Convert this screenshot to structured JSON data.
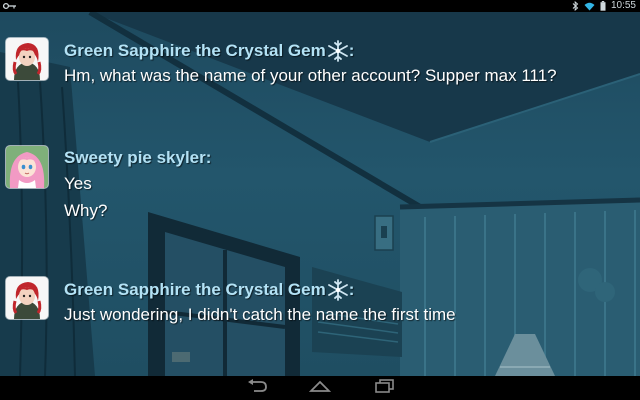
{
  "statusbar": {
    "time": "10:55",
    "icons": [
      "key-icon",
      "bluetooth-icon",
      "wifi-icon",
      "battery-icon"
    ]
  },
  "messages": [
    {
      "username": "Green Sapphire the Crystal Gem",
      "badge_icon": "snowflake-icon",
      "avatar": "red-haired-character-avatar",
      "lines": [
        "Hm, what was the name of your other account? Supper max 111?"
      ]
    },
    {
      "username": "Sweety pie skyler",
      "avatar": "pink-haired-character-avatar",
      "lines": [
        "Yes",
        "Why?"
      ]
    },
    {
      "username": "Green Sapphire the Crystal Gem",
      "badge_icon": "snowflake-icon",
      "avatar": "red-haired-character-avatar",
      "lines": [
        "Just wondering, I didn't catch the name the first time"
      ]
    }
  ],
  "navbar": {
    "buttons": [
      "back-icon",
      "home-icon",
      "recent-apps-icon"
    ]
  },
  "colors": {
    "username": "#b3e2f5",
    "message_text": "#ffffff",
    "bar": "#000000",
    "background": "#1e4a5f"
  }
}
